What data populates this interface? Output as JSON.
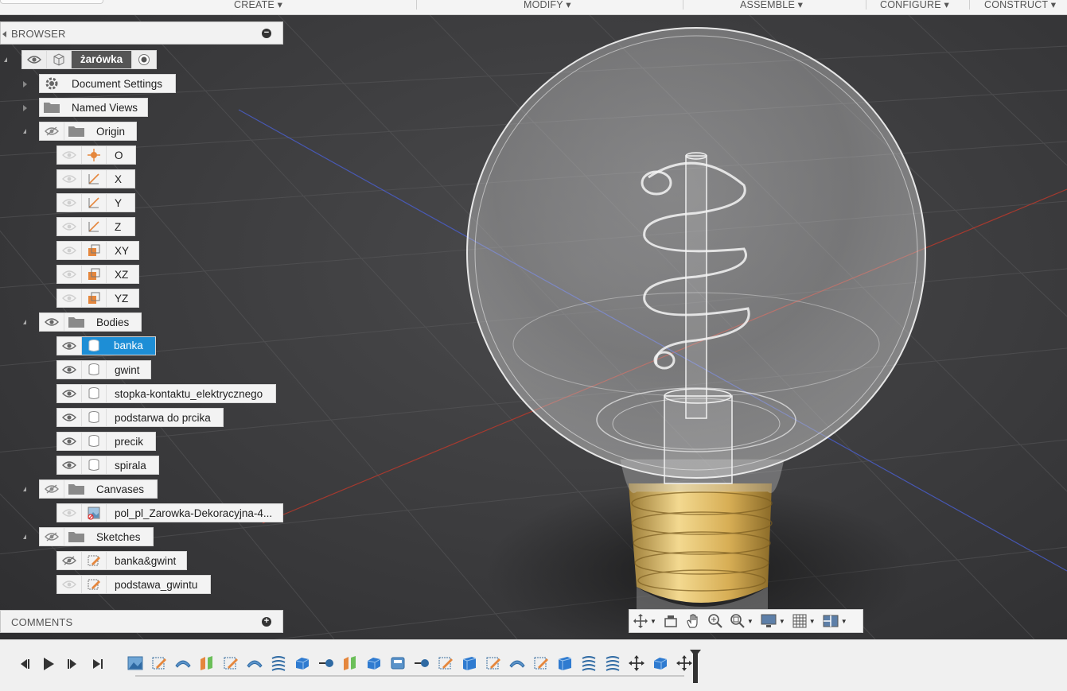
{
  "toolbar": {
    "menus": [
      "CREATE ▾",
      "MODIFY ▾",
      "ASSEMBLE ▾",
      "CONFIGURE ▾",
      "CONSTRUCT ▾"
    ]
  },
  "browser": {
    "title": "BROWSER",
    "collapse_icon": "minus-circle-icon",
    "root": {
      "label": "żarówka",
      "visible": true
    },
    "items": [
      {
        "label": "Document Settings",
        "icon": "gear-icon"
      },
      {
        "label": "Named Views",
        "icon": "folder-icon"
      },
      {
        "label": "Origin",
        "icon": "folder-icon",
        "visible": false
      },
      {
        "label": "O",
        "icon": "origin-point-icon"
      },
      {
        "label": "X",
        "icon": "axis-icon"
      },
      {
        "label": "Y",
        "icon": "axis-icon"
      },
      {
        "label": "Z",
        "icon": "axis-icon"
      },
      {
        "label": "XY",
        "icon": "plane-icon"
      },
      {
        "label": "XZ",
        "icon": "plane-icon"
      },
      {
        "label": "YZ",
        "icon": "plane-icon"
      },
      {
        "label": "Bodies",
        "icon": "folder-icon",
        "visible": true
      },
      {
        "label": "banka",
        "icon": "body-icon",
        "selected": true
      },
      {
        "label": "gwint",
        "icon": "body-icon"
      },
      {
        "label": "stopka-kontaktu_elektrycznego",
        "icon": "body-icon"
      },
      {
        "label": "podstarwa do prcika",
        "icon": "body-icon"
      },
      {
        "label": "precik",
        "icon": "body-icon"
      },
      {
        "label": "spirala",
        "icon": "body-icon"
      },
      {
        "label": "Canvases",
        "icon": "folder-icon",
        "visible": false
      },
      {
        "label": "pol_pl_Zarowka-Dekoracyjna-4...",
        "icon": "canvas-icon"
      },
      {
        "label": "Sketches",
        "icon": "folder-icon",
        "visible": false
      },
      {
        "label": "banka&gwint",
        "icon": "sketch-icon",
        "visible": false
      },
      {
        "label": "podstawa_gwintu",
        "icon": "sketch-icon"
      }
    ]
  },
  "comments": {
    "title": "COMMENTS",
    "add_icon": "plus-circle-icon"
  },
  "navbar": {
    "tools": [
      "orbit-icon",
      "look-at-icon",
      "pan-hand-icon",
      "zoom-icon",
      "fit-zoom-icon",
      "display-mode-icon",
      "grid-icon",
      "viewports-icon"
    ]
  },
  "colors": {
    "selected": "#1d8ed6",
    "thread_gold": "#d6b15a",
    "axis_red": "#c0392b",
    "axis_blue": "#4a5fd1"
  },
  "timeline": {
    "controls": [
      "go-to-start-icon",
      "step-back-icon",
      "play-icon",
      "step-forward-icon",
      "go-to-end-icon"
    ],
    "features": [
      "canvas-feature-icon",
      "sketch-feature-icon",
      "revolve-feature-icon",
      "split-feature-icon",
      "sketch-feature-icon",
      "revolve-feature-icon",
      "coil-feature-icon",
      "body-feature-icon",
      "joint-feature-icon",
      "split-feature-icon",
      "body-feature-icon",
      "shell-feature-icon",
      "joint-feature-icon",
      "sketch-feature-icon",
      "extrude-feature-icon",
      "sketch-feature-icon",
      "revolve-feature-icon",
      "sketch-feature-icon",
      "extrude-feature-icon",
      "coil-feature-icon",
      "coil-feature-icon",
      "move-feature-icon",
      "body-feature-icon",
      "move-feature-icon"
    ]
  }
}
